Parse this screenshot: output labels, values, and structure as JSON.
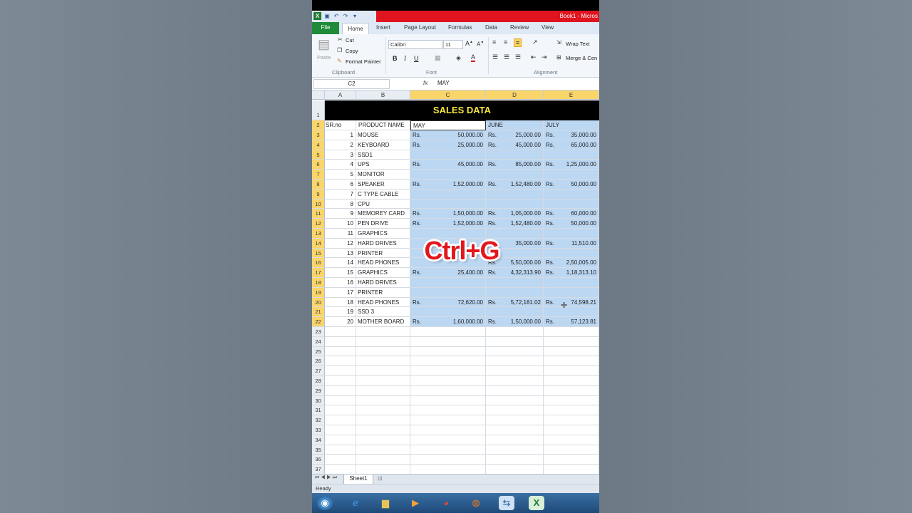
{
  "window": {
    "title": "Book1 - Micros"
  },
  "ribbon_tabs": [
    "File",
    "Home",
    "Insert",
    "Page Layout",
    "Formulas",
    "Data",
    "Review",
    "View"
  ],
  "clipboard": {
    "paste": "Paste",
    "cut": "Cut",
    "copy": "Copy",
    "format_painter": "Format Painter",
    "label": "Clipboard"
  },
  "font": {
    "name": "Calibri",
    "size": "11",
    "label": "Font",
    "bold": "B",
    "italic": "I",
    "underline": "U"
  },
  "alignment": {
    "wrap": "Wrap Text",
    "merge": "Merge & Cen",
    "label": "Alignment"
  },
  "formula_bar": {
    "name_box": "C2",
    "fx": "fx",
    "value": "MAY"
  },
  "columns": [
    "A",
    "B",
    "C",
    "D",
    "E"
  ],
  "title": "SALES DATA",
  "header": {
    "sr": "SR.no",
    "product": "PRODUCT NAME",
    "may": "MAY",
    "june": "JUNE",
    "july": "JULY"
  },
  "currency": "Rs.",
  "rows": [
    {
      "row": "3",
      "sr": "1",
      "product": "MOUSE",
      "may": "50,000.00",
      "june": "25,000.00",
      "july": "35,000.00"
    },
    {
      "row": "4",
      "sr": "2",
      "product": "KEYBOARD",
      "may": "25,000.00",
      "june": "45,000.00",
      "july": "65,000.00"
    },
    {
      "row": "5",
      "sr": "3",
      "product": "SSD1",
      "may": "",
      "june": "",
      "july": ""
    },
    {
      "row": "6",
      "sr": "4",
      "product": "UPS",
      "may": "45,000.00",
      "june": "85,000.00",
      "july": "1,25,000.00"
    },
    {
      "row": "7",
      "sr": "5",
      "product": "MONITOR",
      "may": "",
      "june": "",
      "july": ""
    },
    {
      "row": "8",
      "sr": "6",
      "product": "SPEAKER",
      "may": "1,52,000.00",
      "june": "1,52,480.00",
      "july": "50,000.00"
    },
    {
      "row": "9",
      "sr": "7",
      "product": "C TYPE CABLE",
      "may": "",
      "june": "",
      "july": ""
    },
    {
      "row": "10",
      "sr": "8",
      "product": "CPU",
      "may": "",
      "june": "",
      "july": ""
    },
    {
      "row": "11",
      "sr": "9",
      "product": "MEMOREY CARD",
      "may": "1,50,000.00",
      "june": "1,05,000.00",
      "july": "60,000.00"
    },
    {
      "row": "12",
      "sr": "10",
      "product": "PEN DRIVE",
      "may": "1,52,000.00",
      "june": "1,52,480.00",
      "july": "50,000.00"
    },
    {
      "row": "13",
      "sr": "11",
      "product": "GRAPHICS",
      "may": "",
      "june": "",
      "july": ""
    },
    {
      "row": "14",
      "sr": "12",
      "product": "HARD DRIVES",
      "may": "",
      "june": "35,000.00",
      "july": "11,510.00"
    },
    {
      "row": "15",
      "sr": "13",
      "product": "PRINTER",
      "may": "",
      "june": "",
      "july": ""
    },
    {
      "row": "16",
      "sr": "14",
      "product": "HEAD PHONES",
      "may": "",
      "june": "5,50,000.00",
      "july": "2,50,005.00"
    },
    {
      "row": "17",
      "sr": "15",
      "product": "GRAPHICS",
      "may": "25,400.00",
      "june": "4,32,313.90",
      "july": "1,18,313.10"
    },
    {
      "row": "18",
      "sr": "16",
      "product": "HARD DRIVES",
      "may": "",
      "june": "",
      "july": ""
    },
    {
      "row": "19",
      "sr": "17",
      "product": "PRINTER",
      "may": "",
      "june": "",
      "july": ""
    },
    {
      "row": "20",
      "sr": "18",
      "product": "HEAD PHONES",
      "may": "72,620.00",
      "june": "5,72,181.02",
      "july": "74,598.21"
    },
    {
      "row": "21",
      "sr": "19",
      "product": "SSD 3",
      "may": "",
      "june": "",
      "july": ""
    },
    {
      "row": "22",
      "sr": "20",
      "product": "MOTHER BOARD",
      "may": "1,60,000.00",
      "june": "1,50,000.00",
      "july": "57,123.81"
    }
  ],
  "empty_rows": [
    "23",
    "24",
    "25",
    "26",
    "27",
    "28",
    "29",
    "30",
    "31",
    "32",
    "33",
    "34",
    "35",
    "36",
    "37"
  ],
  "sheet_tab": "Sheet1",
  "status": "Ready",
  "overlay_text": "Ctrl+G"
}
